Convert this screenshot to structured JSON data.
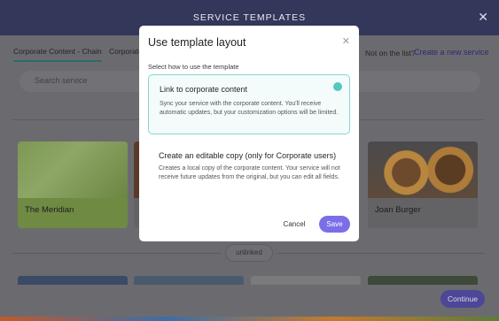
{
  "window": {
    "title": "SERVICE TEMPLATES",
    "close_icon": "close-icon"
  },
  "tabs": [
    {
      "label": "Corporate Content - Chain"
    },
    {
      "label": "Corporate"
    }
  ],
  "header": {
    "not_on_list": "Not on the list?",
    "create_link": "Create a new service"
  },
  "search": {
    "placeholder": "Search service"
  },
  "cards": [
    {
      "label": "The Meridian"
    },
    {
      "label": "Joan Burger"
    }
  ],
  "filter_pill": "unlinked",
  "continue_label": "Continue",
  "modal": {
    "title": "Use template layout",
    "subtitle": "Select how to use the template",
    "options": [
      {
        "title": "Link to corporate content",
        "description": "Sync your service with the corporate content. You'll receive automatic updates, but your customization options will be limited.",
        "selected": true
      },
      {
        "title": "Create an editable copy (only for Corporate users)",
        "description": "Creates a local copy of the corporate content. Your service will not receive future updates from the original, but you can edit all fields.",
        "selected": false
      }
    ],
    "cancel_label": "Cancel",
    "save_label": "Save"
  },
  "colors": {
    "accent": "#7a6fe8",
    "selected_border": "#86d6d2",
    "radio": "#55c7c1"
  }
}
